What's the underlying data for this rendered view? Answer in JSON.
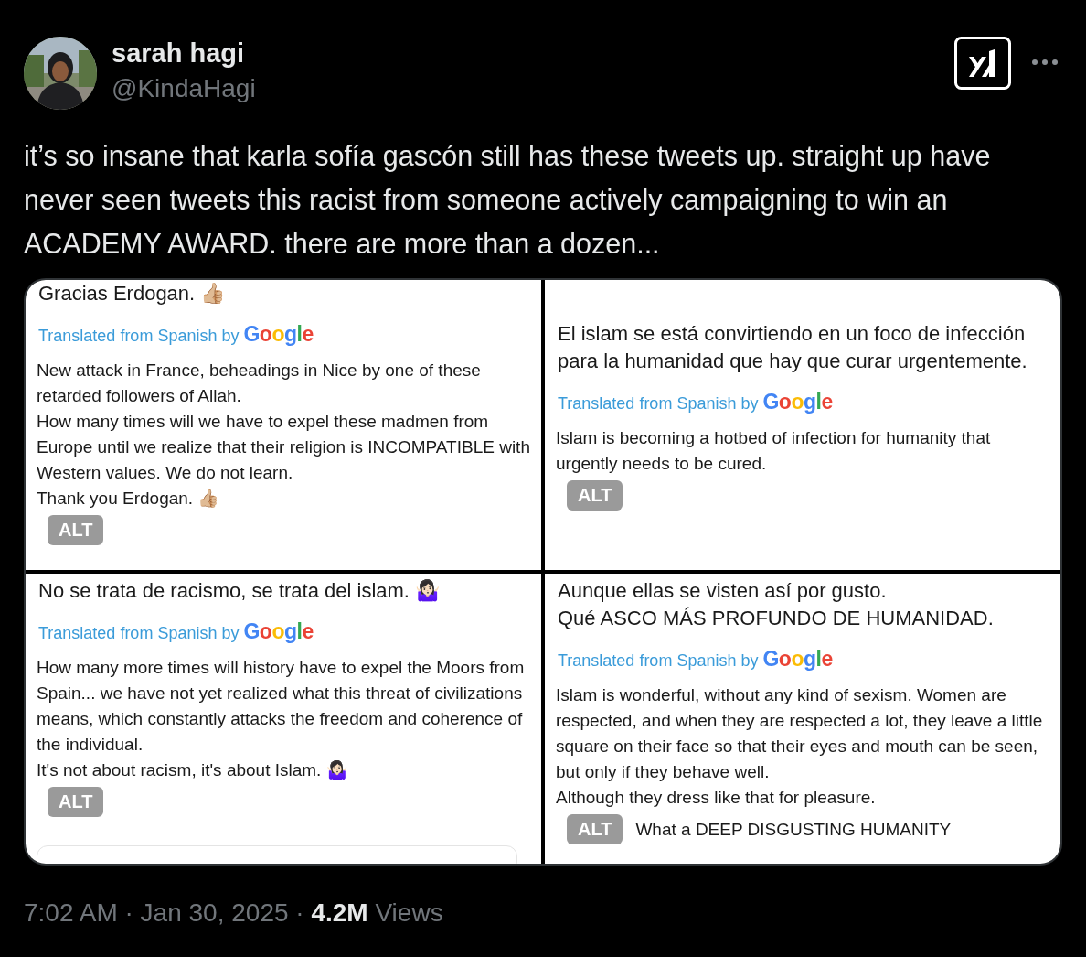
{
  "author": {
    "name": "sarah hagi",
    "handle": "@KindaHagi"
  },
  "text": "it’s so insane that karla sofía gascón still has these tweets up. straight up have never seen tweets this racist from someone actively campaigning to win an ACADEMY AWARD. there are more than a dozen...",
  "images": [
    {
      "top_text": "Gracias Erdogan. 👍🏼",
      "translated_label": "Translated from Spanish by",
      "google": "Google",
      "translation": "New attack in France, beheadings in Nice by one of these retarded followers of Allah.\nHow many times will we have to expel these madmen from Europe until we realize that their religion is INCOMPATIBLE with Western values. We do not learn.\nThank you Erdogan. 👍🏼",
      "quoted_card": false,
      "alt": "ALT"
    },
    {
      "original": "El islam se está convirtiendo en un foco de infección para la humanidad que hay que curar urgentemente.",
      "translated_label": "Translated from Spanish by",
      "google": "Google",
      "translation": "Islam is becoming a hotbed of infection for humanity that urgently needs to be cured.",
      "quoted_card": false,
      "alt": "ALT"
    },
    {
      "original": "No se trata de racismo, se trata del islam. 🤷🏻‍♀️",
      "translated_label": "Translated from Spanish by",
      "google": "Google",
      "translation": "How many more times will history have to expel the Moors from Spain... we have not yet realized what this threat of civilizations means, which constantly attacks the freedom and coherence of the individual.\nIt's not about racism, it's about Islam. 🤷🏻‍♀️",
      "quoted_card": true,
      "alt": "ALT"
    },
    {
      "original": "Aunque ellas se visten así por gusto.\nQué ASCO MÁS PROFUNDO DE HUMANIDAD.",
      "translated_label": "Translated from Spanish by",
      "google": "Google",
      "translation": "Islam is wonderful, without any kind of sexism. Women are respected, and when they are respected a lot, they leave a little square on their face so that their eyes and mouth can be seen, but only if they behave well.\nAlthough they dress like that for pleasure.",
      "bottom_text": "What a DEEP DISGUSTING HUMANITY",
      "quoted_card": false,
      "alt": "ALT"
    }
  ],
  "meta": "7:02 AM · Jan 30, 2025 · **4.2M** Views"
}
